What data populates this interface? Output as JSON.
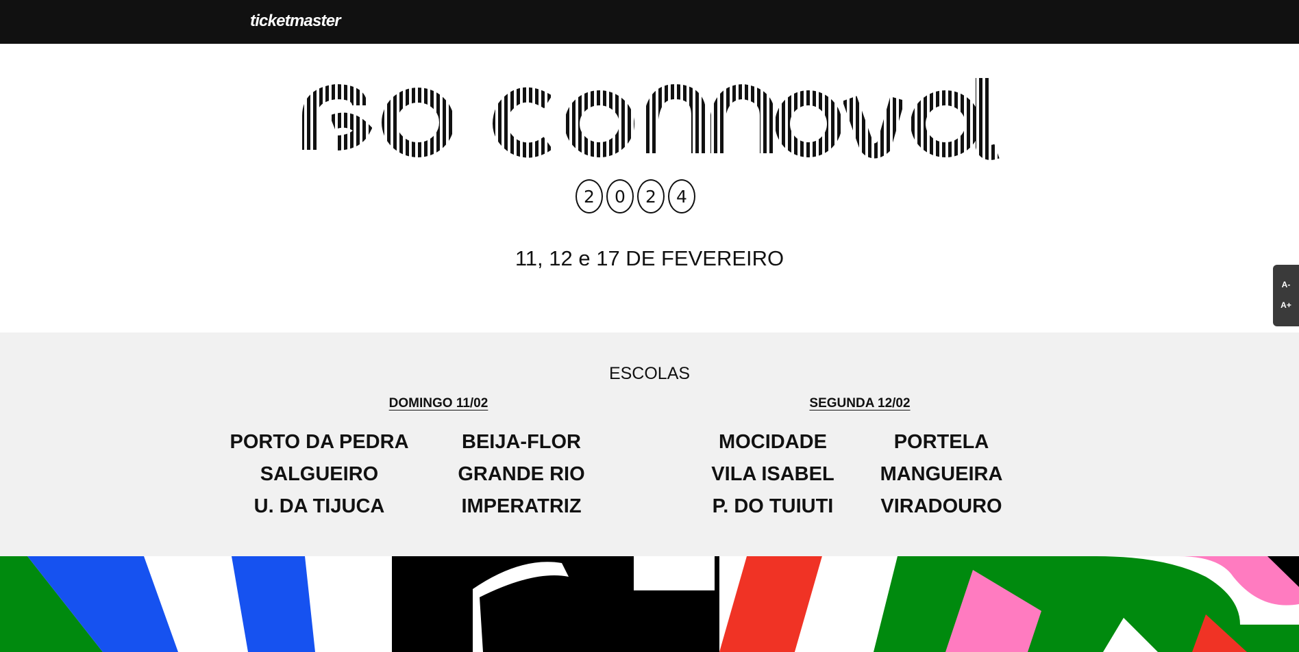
{
  "header": {
    "logo": "ticketmaster"
  },
  "hero": {
    "title": "rio carnaval",
    "year_digits": [
      "2",
      "0",
      "2",
      "4"
    ],
    "dates": "11, 12 e 17 DE FEVEREIRO"
  },
  "font_controls": {
    "decrease": "A-",
    "increase": "A+"
  },
  "schools": {
    "title": "ESCOLAS",
    "days": [
      {
        "label": "DOMINGO 11/02",
        "schools": [
          "PORTO DA PEDRA",
          "BEIJA-FLOR",
          "SALGUEIRO",
          "GRANDE RIO",
          "U. DA TIJUCA",
          "IMPERATRIZ"
        ]
      },
      {
        "label": "SEGUNDA 12/02",
        "schools": [
          "MOCIDADE",
          "PORTELA",
          "VILA ISABEL",
          "MANGUEIRA",
          "P. DO TUIUTI",
          "VIRADOURO"
        ]
      }
    ]
  },
  "colors": {
    "header_bg": "#111111",
    "section_bg": "#f1f1f1",
    "banner_green": "#008a0e",
    "banner_blue": "#1652f0",
    "banner_red": "#f03325",
    "banner_pink": "#ff7bc0"
  }
}
